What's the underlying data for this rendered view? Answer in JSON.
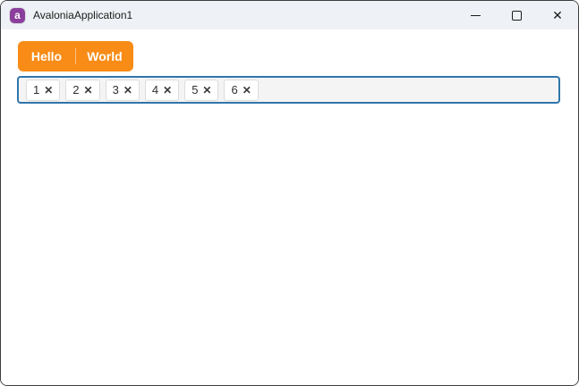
{
  "window": {
    "title": "AvaloniaApplication1",
    "app_icon_letter": "a",
    "controls": {
      "minimize_label": "minimize",
      "maximize_label": "maximize",
      "close_label": "close",
      "close_glyph": "✕"
    }
  },
  "tabstrip": {
    "items": [
      {
        "label": "Hello"
      },
      {
        "label": "World"
      }
    ]
  },
  "chipbox": {
    "items": [
      {
        "label": "1"
      },
      {
        "label": "2"
      },
      {
        "label": "3"
      },
      {
        "label": "4"
      },
      {
        "label": "5"
      },
      {
        "label": "6"
      }
    ],
    "remove_glyph": "✕"
  },
  "colors": {
    "accent_orange": "#F88C16",
    "focus_border_blue": "#2E76AB",
    "titlebar_bg": "#EEF2F6",
    "logo_purple": "#8B3F9C",
    "chip_border": "#DCDCDC",
    "chipbox_bg": "#F4F4F4",
    "window_border": "#3D3D3D"
  }
}
